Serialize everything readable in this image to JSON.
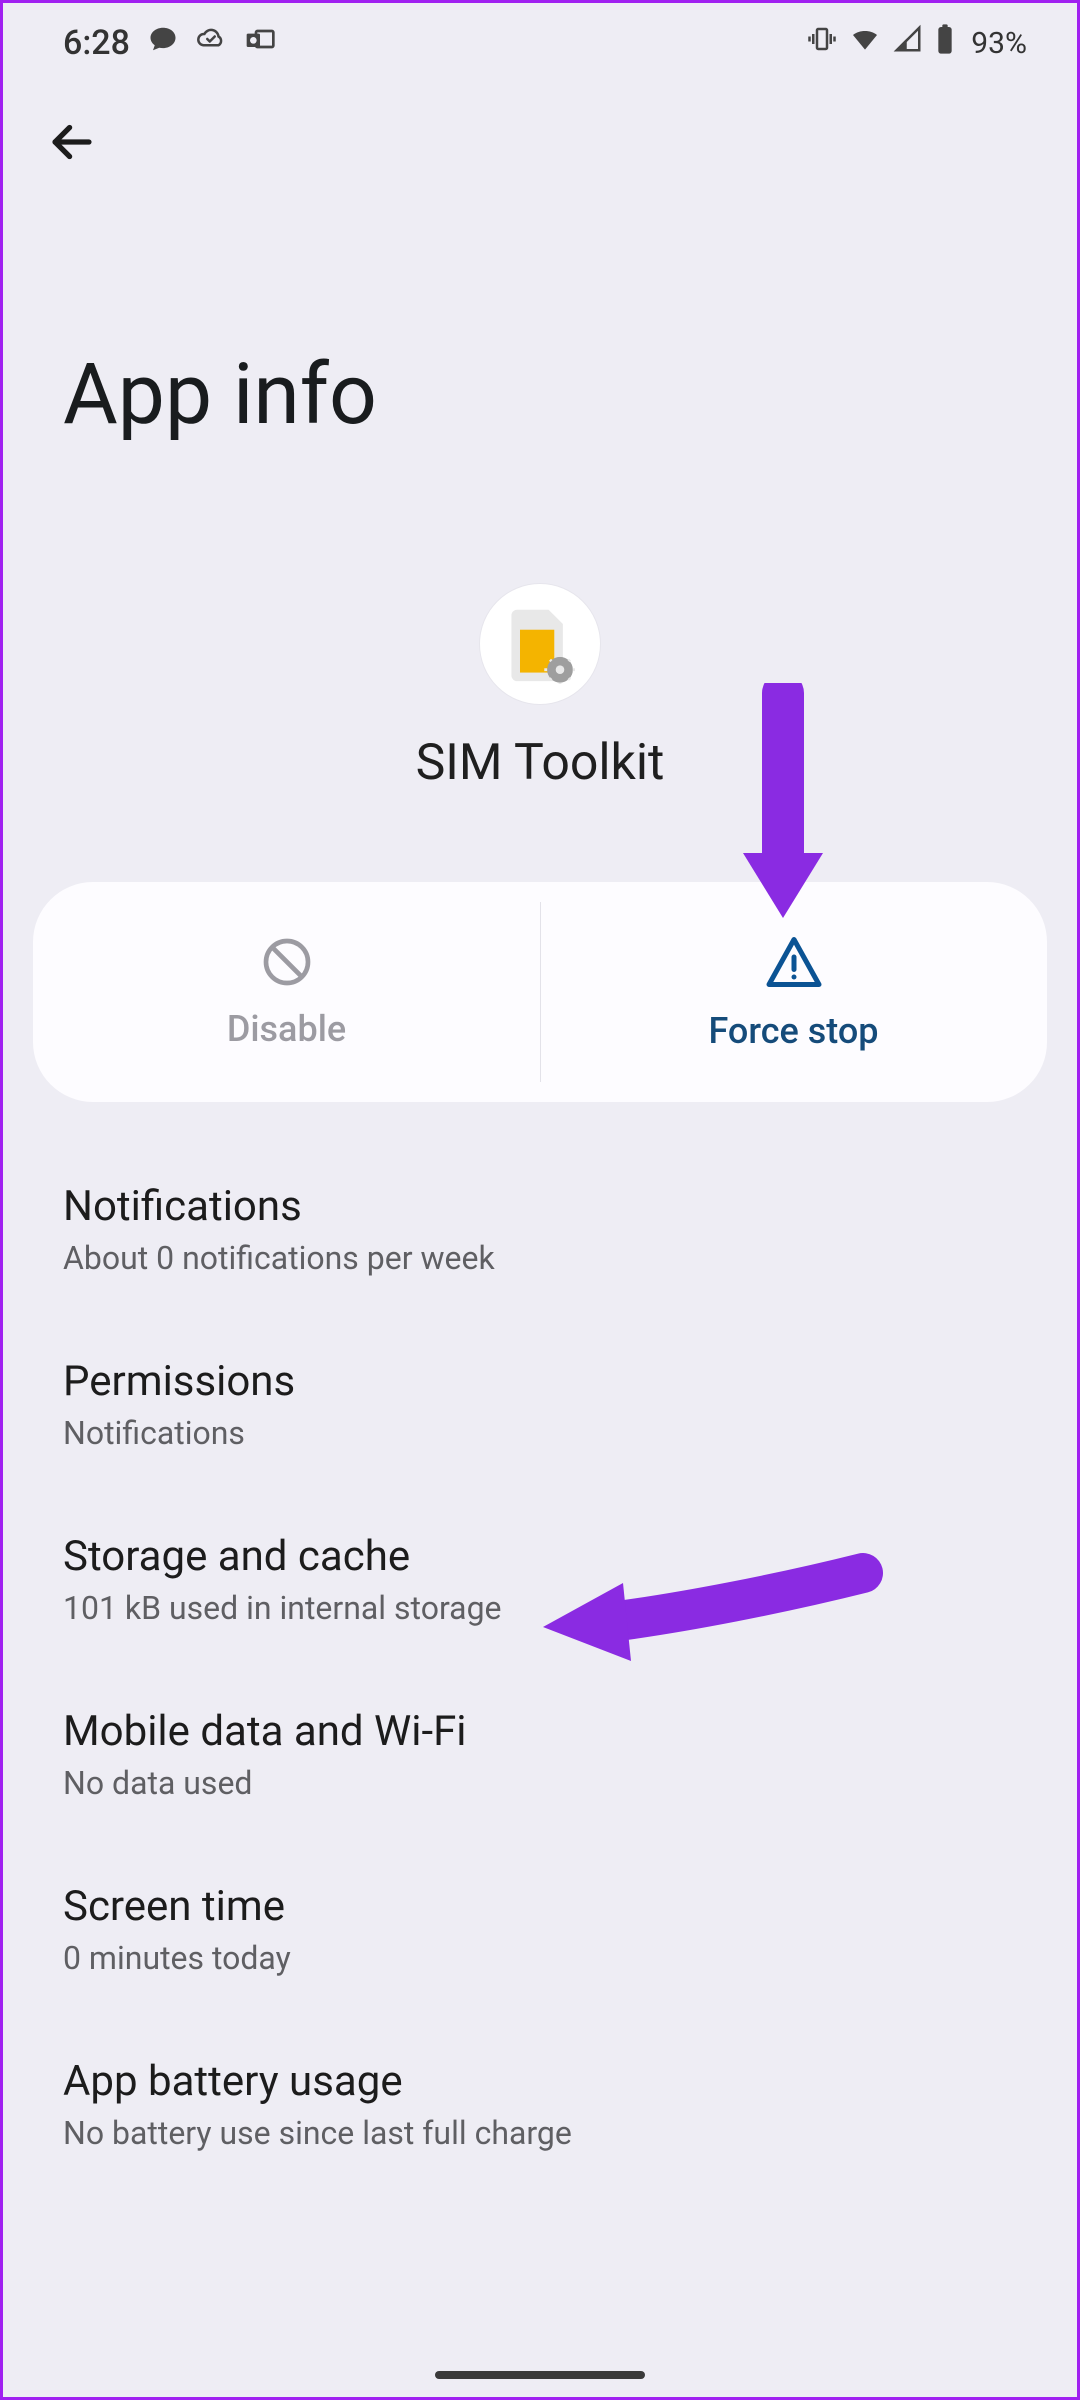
{
  "status": {
    "time": "6:28",
    "battery_pct": "93%"
  },
  "page_title": "App info",
  "app": {
    "name": "SIM Toolkit"
  },
  "actions": {
    "disable": "Disable",
    "force_stop": "Force stop"
  },
  "settings": {
    "notifications": {
      "title": "Notifications",
      "sub": "About 0 notifications per week"
    },
    "permissions": {
      "title": "Permissions",
      "sub": "Notifications"
    },
    "storage": {
      "title": "Storage and cache",
      "sub": "101 kB used in internal storage"
    },
    "data": {
      "title": "Mobile data and Wi-Fi",
      "sub": "No data used"
    },
    "screen_time": {
      "title": "Screen time",
      "sub": "0 minutes today"
    },
    "battery": {
      "title": "App battery usage",
      "sub": "No battery use since last full charge"
    }
  }
}
